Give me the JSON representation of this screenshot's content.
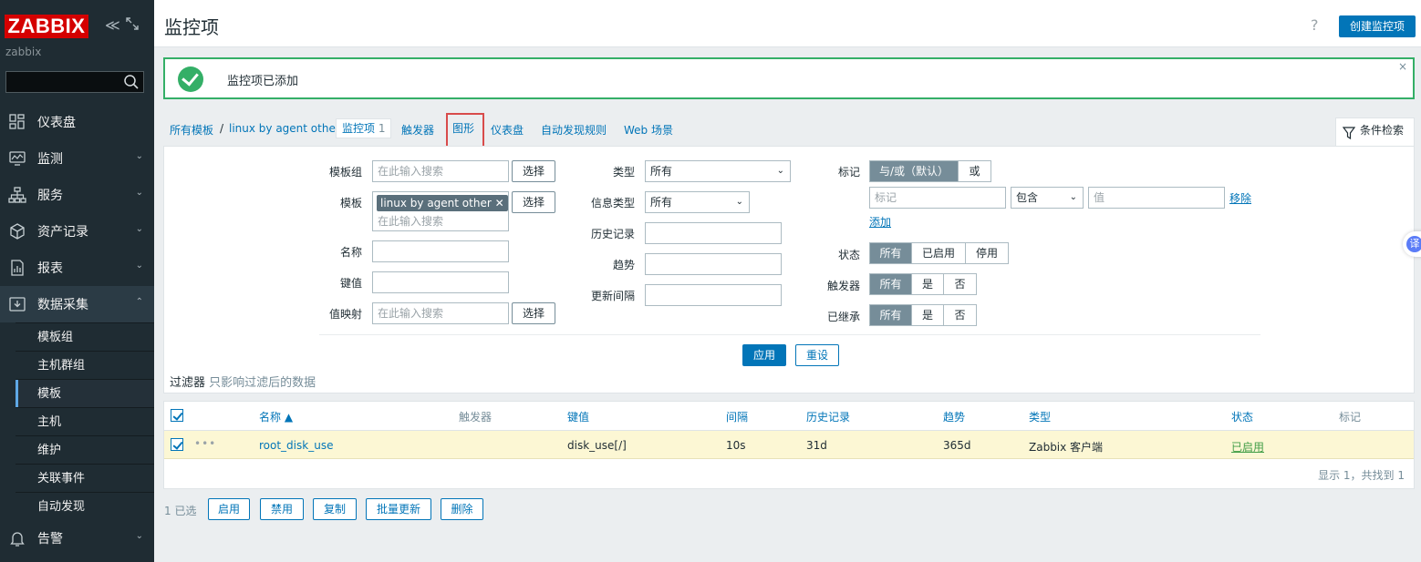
{
  "sidebar": {
    "logo": "ZABBIX",
    "server_name": "zabbix",
    "menu": [
      {
        "label": "仪表盘",
        "icon": "dashboard-icon"
      },
      {
        "label": "监测",
        "icon": "monitoring-icon"
      },
      {
        "label": "服务",
        "icon": "services-icon"
      },
      {
        "label": "资产记录",
        "icon": "inventory-icon"
      },
      {
        "label": "报表",
        "icon": "reports-icon"
      },
      {
        "label": "数据采集",
        "icon": "data-collection-icon"
      }
    ],
    "submenu": [
      "模板组",
      "主机群组",
      "模板",
      "主机",
      "维护",
      "关联事件",
      "自动发现"
    ],
    "bottom_item": {
      "label": "告警",
      "icon": "alerts-icon"
    }
  },
  "header": {
    "title": "监控项",
    "help": "?",
    "create_button": "创建监控项"
  },
  "message": {
    "text": "监控项已添加",
    "close": "×"
  },
  "nav": {
    "all_templates": "所有模板",
    "separator": "/",
    "template": "linux by agent other",
    "items_label": "监控项",
    "items_count": "1",
    "triggers": "触发器",
    "graphs": "图形",
    "dashboards": "仪表盘",
    "discovery": "自动发现规则",
    "web": "Web 场景",
    "filter_tab": "条件检索"
  },
  "filter": {
    "template_group_label": "模板组",
    "template_label": "模板",
    "name_label": "名称",
    "key_label": "键值",
    "valuemap_label": "值映射",
    "search_placeholder": "在此输入搜索",
    "select_button": "选择",
    "template_chip": "linux by agent other",
    "chip_remove": "✕",
    "type_label": "类型",
    "type_value": "所有",
    "info_type_label": "信息类型",
    "info_type_value": "所有",
    "history_label": "历史记录",
    "trends_label": "趋势",
    "interval_label": "更新间隔",
    "tags_label": "标记",
    "tags_andor": "与/或（默认）",
    "tags_or": "或",
    "tag_placeholder": "标记",
    "tag_operator": "包含",
    "value_placeholder": "值",
    "remove_link": "移除",
    "add_link": "添加",
    "status_label": "状态",
    "status_options": [
      "所有",
      "已启用",
      "停用"
    ],
    "triggers_label": "触发器",
    "yesno_options": [
      "所有",
      "是",
      "否"
    ],
    "inherited_label": "已继承",
    "apply_button": "应用",
    "reset_button": "重设",
    "note_strong": "过滤器",
    "note_muted": "只影响过滤后的数据"
  },
  "table": {
    "columns": [
      "名称 ▲",
      "触发器",
      "键值",
      "间隔",
      "历史记录",
      "趋势",
      "类型",
      "状态",
      "标记"
    ],
    "rows": [
      {
        "name": "root_disk_use",
        "triggers": "",
        "key": "disk_use[/]",
        "interval": "10s",
        "history": "31d",
        "trends": "365d",
        "type": "Zabbix 客户端",
        "status": "已启用",
        "tags": ""
      }
    ],
    "row_menu": "•••",
    "summary": "显示 1，共找到 1"
  },
  "actions": {
    "selected": "1 已选",
    "buttons": [
      "启用",
      "禁用",
      "复制",
      "批量更新",
      "删除"
    ]
  },
  "translate_badge": "译",
  "colors": {
    "sidebar_bg": "#1f2c33",
    "accent": "#0275b8",
    "success": "#34af67",
    "logo_red": "#d40000",
    "row_highlight": "#fcf7d4",
    "annotation_red": "#d84b4b"
  }
}
